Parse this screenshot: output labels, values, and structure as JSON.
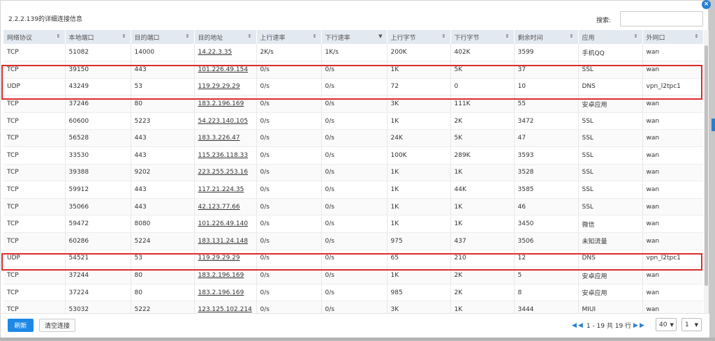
{
  "dialog": {
    "title": "2.2.2.139的详细连接信息",
    "search_label": "搜索:",
    "search_value": "",
    "search_placeholder": "",
    "close_icon": "×"
  },
  "table": {
    "headers": [
      "网络协议",
      "本地端口",
      "目的端口",
      "目的地址",
      "上行速率",
      "下行速率",
      "上行字节",
      "下行字节",
      "剩余时间",
      "应用",
      "外网口"
    ],
    "sort_indicators": [
      "⇕",
      "⇕",
      "⇕",
      "⇕",
      "⇕",
      "▼",
      "⇕",
      "⇕",
      "⇕",
      "⇕",
      "⇕"
    ],
    "rows": [
      [
        "TCP",
        "51082",
        "14000",
        "14.22.3.35",
        "2K/s",
        "1K/s",
        "200K",
        "402K",
        "3599",
        "手机QQ",
        "wan"
      ],
      [
        "TCP",
        "39150",
        "443",
        "101.226.49.154",
        "0/s",
        "0/s",
        "1K",
        "5K",
        "37",
        "SSL",
        "wan"
      ],
      [
        "UDP",
        "43249",
        "53",
        "119.29.29.29",
        "0/s",
        "0/s",
        "72",
        "0",
        "10",
        "DNS",
        "vpn_l2tpc1"
      ],
      [
        "TCP",
        "37246",
        "80",
        "183.2.196.169",
        "0/s",
        "0/s",
        "3K",
        "111K",
        "55",
        "安卓应用",
        "wan"
      ],
      [
        "TCP",
        "60600",
        "5223",
        "54.223.140.105",
        "0/s",
        "0/s",
        "1K",
        "2K",
        "3472",
        "SSL",
        "wan"
      ],
      [
        "TCP",
        "56528",
        "443",
        "183.3.226.47",
        "0/s",
        "0/s",
        "24K",
        "5K",
        "47",
        "SSL",
        "wan"
      ],
      [
        "TCP",
        "33530",
        "443",
        "115.236.118.33",
        "0/s",
        "0/s",
        "100K",
        "289K",
        "3593",
        "SSL",
        "wan"
      ],
      [
        "TCP",
        "39388",
        "9202",
        "223.255.253.16",
        "0/s",
        "0/s",
        "1K",
        "1K",
        "3528",
        "SSL",
        "wan"
      ],
      [
        "TCP",
        "59912",
        "443",
        "117.21.224.35",
        "0/s",
        "0/s",
        "1K",
        "44K",
        "3585",
        "SSL",
        "wan"
      ],
      [
        "TCP",
        "35066",
        "443",
        "42.123.77.66",
        "0/s",
        "0/s",
        "1K",
        "1K",
        "46",
        "SSL",
        "wan"
      ],
      [
        "TCP",
        "59472",
        "8080",
        "101.226.49.140",
        "0/s",
        "0/s",
        "1K",
        "1K",
        "3450",
        "微信",
        "wan"
      ],
      [
        "TCP",
        "60286",
        "5224",
        "183.131.24.148",
        "0/s",
        "0/s",
        "975",
        "437",
        "3506",
        "未知流量",
        "wan"
      ],
      [
        "UDP",
        "54521",
        "53",
        "119.29.29.29",
        "0/s",
        "0/s",
        "65",
        "210",
        "12",
        "DNS",
        "vpn_l2tpc1"
      ],
      [
        "TCP",
        "37244",
        "80",
        "183.2.196.169",
        "0/s",
        "0/s",
        "1K",
        "2K",
        "5",
        "安卓应用",
        "wan"
      ],
      [
        "TCP",
        "37224",
        "80",
        "183.2.196.169",
        "0/s",
        "0/s",
        "985",
        "2K",
        "8",
        "安卓应用",
        "wan"
      ],
      [
        "TCP",
        "53032",
        "5222",
        "123.125.102.214",
        "0/s",
        "0/s",
        "3K",
        "1K",
        "3444",
        "MIUI",
        "wan"
      ]
    ]
  },
  "footer": {
    "refresh_label": "刷新",
    "clear_label": "清空连接",
    "page_info": "1 - 19 共 19 行",
    "page_size": "40",
    "page_number": "1",
    "first_icon": "◀",
    "prev_icon": "◀",
    "next_icon": "▶",
    "last_icon": "▶"
  },
  "colors": {
    "highlight": "#e02a2a",
    "accent": "#1e88e5",
    "header_bg": "#e3e9f1"
  }
}
